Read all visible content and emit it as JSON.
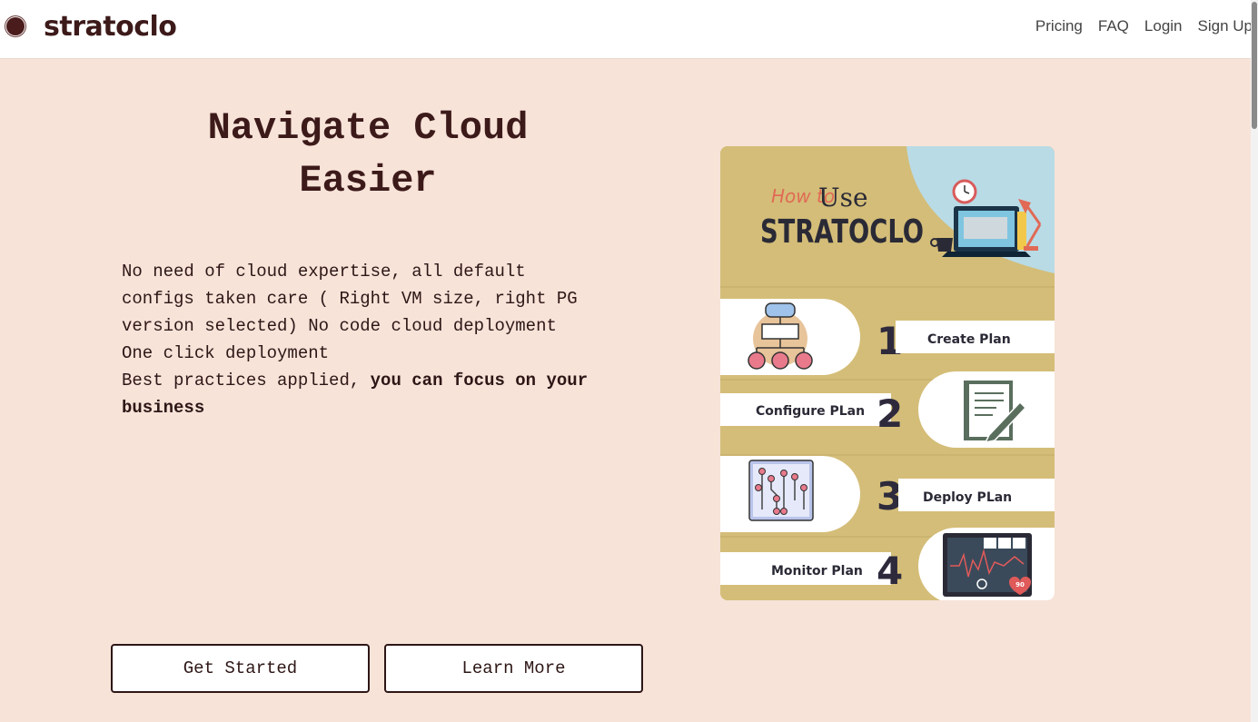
{
  "brand": {
    "name": "stratoclo"
  },
  "nav": {
    "items": [
      "Pricing",
      "FAQ",
      "Login",
      "Sign Up"
    ]
  },
  "hero": {
    "title_line1": "Navigate Cloud",
    "title_line2": "Easier",
    "paragraph_lines": [
      "No need of cloud expertise, all default",
      "configs taken care ( Right VM size, right PG",
      "version selected) No code cloud deployment",
      "One click deployment"
    ],
    "last_line_normal": "Best practices applied, ",
    "last_line_bold": "you can focus on your business"
  },
  "buttons": {
    "get_started": "Get Started",
    "learn_more": "Learn More"
  },
  "infographic": {
    "how_to": "How to",
    "use": "Use",
    "product": "STRATOCLO",
    "steps": [
      {
        "number": "1",
        "label": "Create Plan"
      },
      {
        "number": "2",
        "label": "Configure PLan"
      },
      {
        "number": "3",
        "label": "Deploy PLan"
      },
      {
        "number": "4",
        "label": "Monitor Plan"
      }
    ],
    "monitor_reading": "90"
  },
  "colors": {
    "brand": "#3d1a1a",
    "background": "#f7e3d8",
    "infographic_gold": "#d4bd78",
    "accent_blue": "#b9dbe6"
  }
}
